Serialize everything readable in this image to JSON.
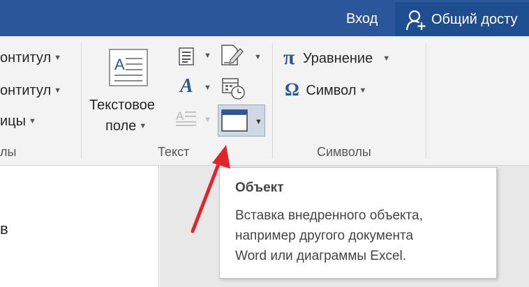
{
  "titlebar": {
    "signin_label": "Вход",
    "share_label": "Общий досту"
  },
  "ribbon": {
    "left_group": {
      "items": [
        "онтитул",
        "онтитул",
        "ицы"
      ],
      "label": "лы"
    },
    "text_group": {
      "label": "Текст",
      "textbox_line1": "Текстовое",
      "textbox_line2": "поле"
    },
    "symbols_group": {
      "label": "Символы",
      "equation_label": "Уравнение",
      "symbol_label": "Символ",
      "pi_glyph": "π",
      "omega_glyph": "Ω"
    }
  },
  "document": {
    "text": "в"
  },
  "tooltip": {
    "title": "Объект",
    "lines": [
      "Вставка внедренного объекта,",
      "например другого документа",
      "Word или диаграммы Excel."
    ]
  },
  "colors": {
    "titlebar": "#2b579a",
    "accent": "#2b579a",
    "arrow": "#e0262b"
  }
}
